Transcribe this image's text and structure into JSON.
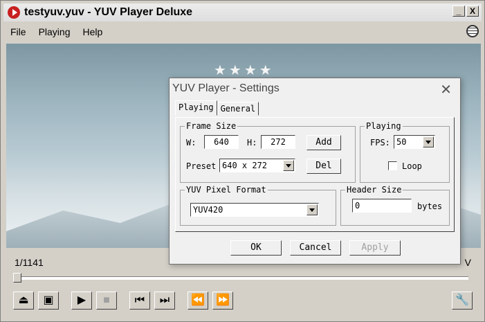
{
  "window": {
    "title": "testyuv.yuv - YUV Player Deluxe",
    "minimize": "_",
    "close": "X"
  },
  "menu": [
    "File",
    "Playing",
    "Help"
  ],
  "player": {
    "frame_counter": "1/1141",
    "right_label": "V"
  },
  "settings": {
    "title": "YUV Player - Settings",
    "tabs": [
      "Playing",
      "General"
    ],
    "frame_size": {
      "legend": "Frame Size",
      "w_label": "W:",
      "w_value": "640",
      "h_label": "H:",
      "h_value": "272",
      "add": "Add",
      "preset_label": "Preset",
      "preset_value": "640 x 272",
      "del": "Del"
    },
    "playing": {
      "legend": "Playing",
      "fps_label": "FPS:",
      "fps_value": "50",
      "loop_label": "Loop",
      "loop_checked": false
    },
    "pixel_format": {
      "legend": "YUV Pixel Format",
      "value": "YUV420"
    },
    "header_size": {
      "legend": "Header Size",
      "value": "0",
      "unit": "bytes"
    },
    "buttons": {
      "ok": "OK",
      "cancel": "Cancel",
      "apply": "Apply"
    }
  }
}
